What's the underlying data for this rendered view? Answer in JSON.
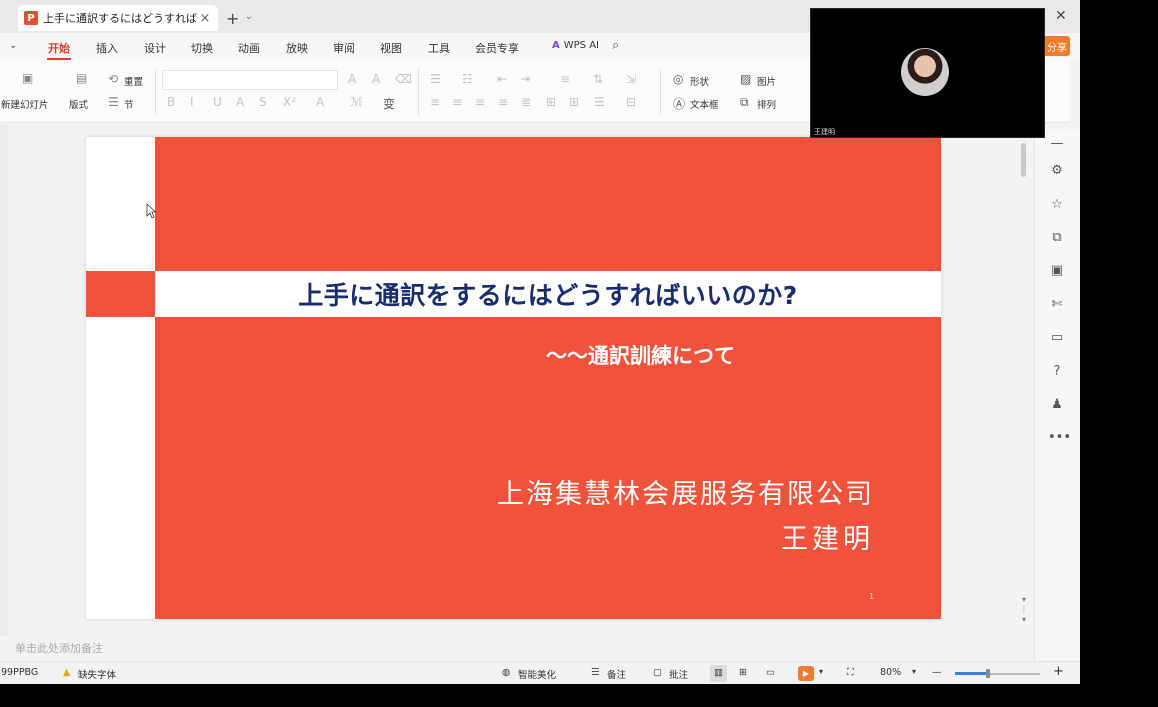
{
  "tab": {
    "title": "上手に通訳するにはどうすればい",
    "close": "×",
    "new": "+",
    "menu": "⌄"
  },
  "window": {
    "close": "✕"
  },
  "ribbon": {
    "chevron": "⌄",
    "tabs": [
      "开始",
      "插入",
      "设计",
      "切换",
      "动画",
      "放映",
      "审阅",
      "视图",
      "工具",
      "会员专享"
    ],
    "wps_ai": "WPS AI",
    "share": "分享"
  },
  "toolbar": {
    "new_slide": "新建幻灯片",
    "layout": "版式",
    "reset": "重置",
    "section": "节",
    "shape": "形状",
    "picture": "图片",
    "textbox": "文本框",
    "arrange": "排列"
  },
  "slide": {
    "title": "上手に通訳をするにはどうすればいいのか?",
    "subtitle": "～～通訳訓練につて",
    "company": "上海集慧林会展服务有限公司",
    "author": "王建明",
    "page_number": "1",
    "colors": {
      "accent": "#f0523b",
      "title": "#1a2e6e"
    }
  },
  "notes": {
    "placeholder": "单击此处添加备注"
  },
  "statusbar": {
    "left_code": "99PPBG",
    "missing_font": "缺失字体",
    "smart_beautify": "智能美化",
    "notes": "备注",
    "comments": "批注",
    "zoom": "80%",
    "zoom_level": 0.38
  },
  "video": {
    "participant_name": "王建明"
  },
  "sidebar_icons": [
    "minus-icon",
    "sliders-icon",
    "star-icon",
    "layers-icon",
    "image-edit-icon",
    "magic-icon",
    "book-icon",
    "help-icon",
    "shirt-icon",
    "more-icon"
  ]
}
